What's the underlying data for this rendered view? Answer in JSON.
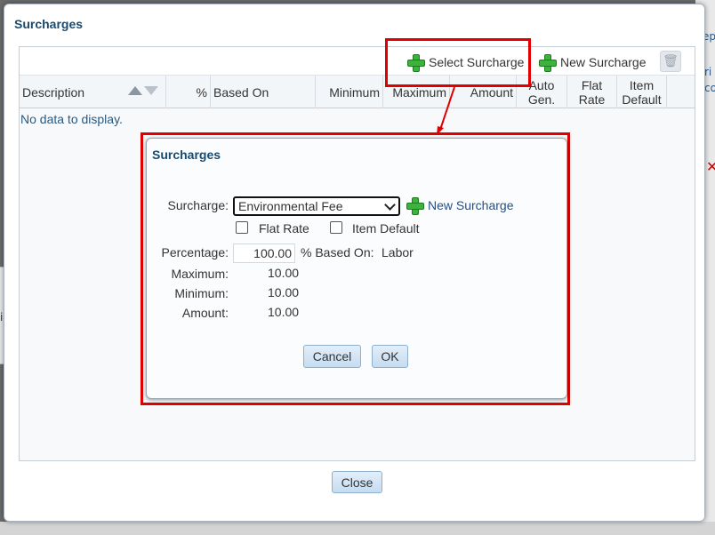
{
  "background": {
    "right_text_1": "ep",
    "right_text_2": "ri",
    "right_text_3": "co",
    "left_text_1": "in",
    "left_text_2": "H"
  },
  "outer_dialog": {
    "title": "Surcharges",
    "toolbar": {
      "select_surcharge": "Select Surcharge",
      "new_surcharge": "New Surcharge",
      "delete_icon": "trash-icon"
    },
    "columns": {
      "description": "Description",
      "percent": "%",
      "based_on": "Based On",
      "minimum": "Minimum",
      "maximum": "Maximum",
      "amount": "Amount",
      "auto_gen_1": "Auto",
      "auto_gen_2": "Gen.",
      "flat_rate_1": "Flat",
      "flat_rate_2": "Rate",
      "item_default_1": "Item",
      "item_default_2": "Default"
    },
    "empty_text": "No data to display.",
    "close_label": "Close"
  },
  "inner_dialog": {
    "title": "Surcharges",
    "surcharge_label": "Surcharge:",
    "surcharge_value": "Environmental Fee",
    "new_surcharge_link": "New Surcharge",
    "flat_rate_label": "Flat Rate",
    "item_default_label": "Item Default",
    "percentage_label": "Percentage:",
    "percentage_value": "100.00",
    "based_on_label": "% Based On:",
    "based_on_value": "Labor",
    "maximum_label": "Maximum:",
    "maximum_value": "10.00",
    "minimum_label": "Minimum:",
    "minimum_value": "10.00",
    "amount_label": "Amount:",
    "amount_value": "10.00",
    "cancel_label": "Cancel",
    "ok_label": "OK"
  },
  "colors": {
    "highlight": "#e00000",
    "title": "#1a4a6e",
    "link": "#1f4f8c",
    "plus": "#3cb43c"
  }
}
